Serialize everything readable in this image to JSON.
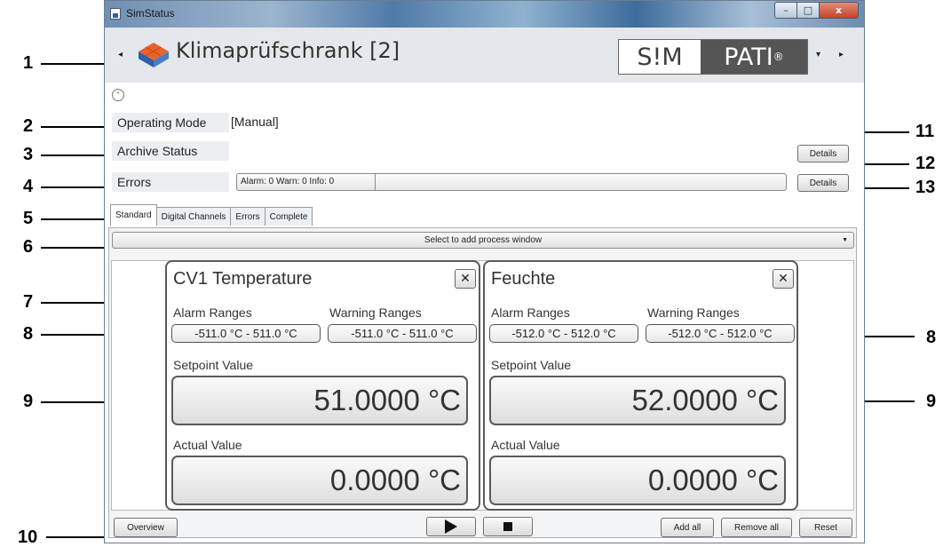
{
  "window": {
    "title": "SimStatus",
    "min": "–",
    "max": "□",
    "close": "x"
  },
  "header": {
    "app_title": "Klimaprüfschrank [2]",
    "logo_left": "S!M",
    "logo_right": "PATI",
    "logo_reg": "®",
    "nav_prev": "◂",
    "nav_down": "▾",
    "nav_next": "▸"
  },
  "collapse_glyph": "˄",
  "status": {
    "operating_mode_label": "Operating Mode",
    "operating_mode_value": "[Manual]",
    "archive_status_label": "Archive Status",
    "errors_label": "Errors",
    "errors_summary": "Alarm: 0  Warn: 0  Info: 0",
    "details_label": "Details"
  },
  "tabs": [
    "Standard",
    "Digital Channels",
    "Errors",
    "Complete"
  ],
  "process_select": {
    "placeholder": "Select to add process window",
    "arrow": "▼"
  },
  "panels": [
    {
      "title": "CV1 Temperature",
      "close": "✕",
      "alarm_label": "Alarm Ranges",
      "warning_label": "Warning Ranges",
      "alarm_range": "-511.0 °C  -  511.0 °C",
      "warning_range": "-511.0 °C  -  511.0 °C",
      "setpoint_label": "Setpoint Value",
      "setpoint_value": "51.0000 °C",
      "actual_label": "Actual Value",
      "actual_value": "0.0000 °C"
    },
    {
      "title": "Feuchte",
      "close": "✕",
      "alarm_label": "Alarm Ranges",
      "warning_label": "Warning Ranges",
      "alarm_range": "-512.0 °C  -  512.0 °C",
      "warning_range": "-512.0 °C  -  512.0 °C",
      "setpoint_label": "Setpoint Value",
      "setpoint_value": "52.0000 °C",
      "actual_label": "Actual Value",
      "actual_value": "0.0000 °C"
    }
  ],
  "footer": {
    "overview": "Overview",
    "add_all": "Add all",
    "remove_all": "Remove all",
    "reset": "Reset"
  },
  "callouts": [
    "1",
    "2",
    "3",
    "4",
    "5",
    "6",
    "7",
    "8",
    "9",
    "10",
    "11",
    "12",
    "13"
  ],
  "colors": {
    "logo_dark": "#555555",
    "panel_border": "#5a5a5a",
    "header_bg": "#e4e7eb"
  }
}
